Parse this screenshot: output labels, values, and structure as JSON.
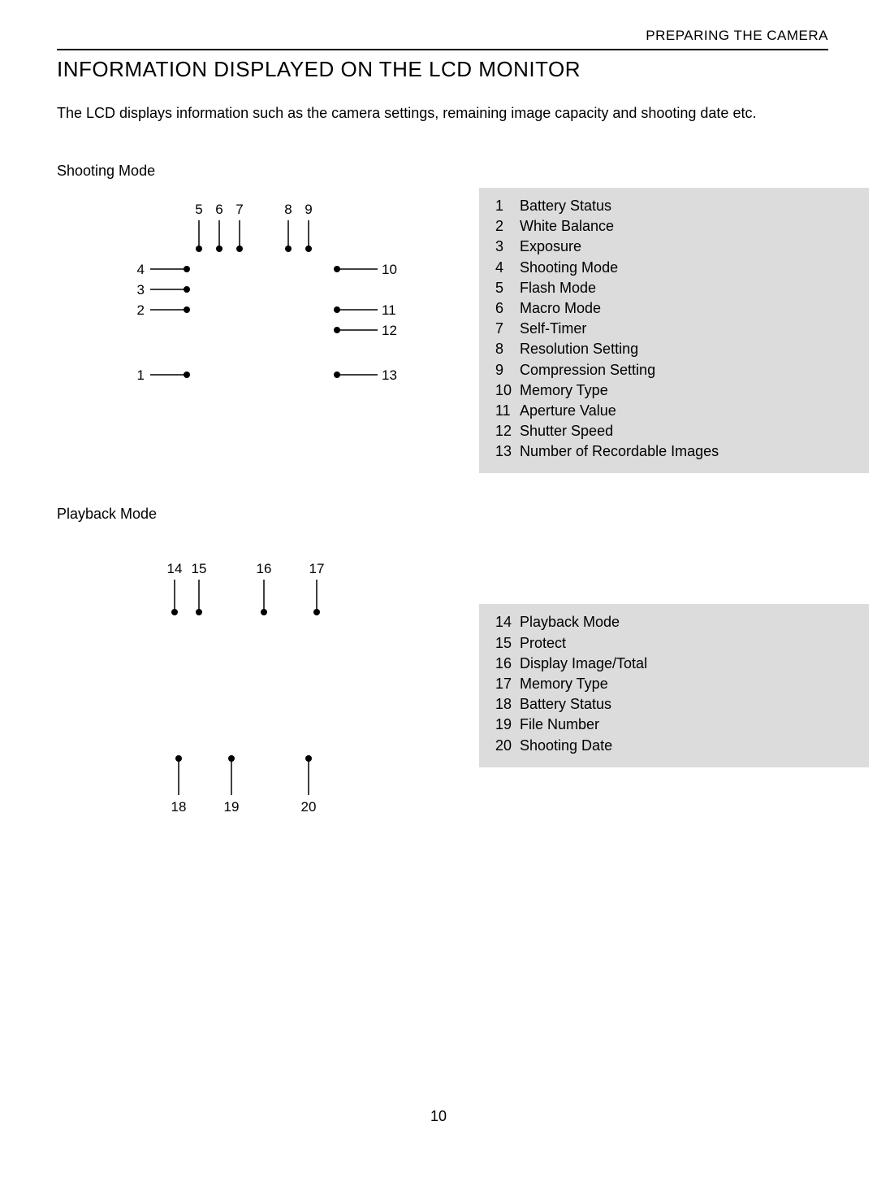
{
  "header": {
    "chapter": "PREPARING THE CAMERA",
    "title": "INFORMATION DISPLAYED ON THE LCD MONITOR",
    "intro": "The LCD displays information such as the camera settings, remaining image capacity and shooting date etc."
  },
  "shooting": {
    "heading": "Shooting Mode",
    "callouts": [
      "1",
      "2",
      "3",
      "4",
      "5",
      "6",
      "7",
      "8",
      "9",
      "10",
      "11",
      "12",
      "13"
    ],
    "legend": [
      {
        "n": "1",
        "label": "Battery Status"
      },
      {
        "n": "2",
        "label": "White Balance"
      },
      {
        "n": "3",
        "label": "Exposure"
      },
      {
        "n": "4",
        "label": "Shooting Mode"
      },
      {
        "n": "5",
        "label": "Flash Mode"
      },
      {
        "n": "6",
        "label": "Macro Mode"
      },
      {
        "n": "7",
        "label": "Self-Timer"
      },
      {
        "n": "8",
        "label": "Resolution Setting"
      },
      {
        "n": "9",
        "label": "Compression Setting"
      },
      {
        "n": "10",
        "label": "Memory Type"
      },
      {
        "n": "11",
        "label": "Aperture Value"
      },
      {
        "n": "12",
        "label": "Shutter Speed"
      },
      {
        "n": "13",
        "label": "Number of Recordable Images"
      }
    ]
  },
  "playback": {
    "heading": "Playback Mode",
    "callouts": [
      "14",
      "15",
      "16",
      "17",
      "18",
      "19",
      "20"
    ],
    "legend": [
      {
        "n": "14",
        "label": "Playback Mode"
      },
      {
        "n": "15",
        "label": "Protect"
      },
      {
        "n": "16",
        "label": "Display Image/Total"
      },
      {
        "n": "17",
        "label": "Memory Type"
      },
      {
        "n": "18",
        "label": "Battery Status"
      },
      {
        "n": "19",
        "label": "File Number"
      },
      {
        "n": "20",
        "label": "Shooting Date"
      }
    ]
  },
  "page_number": "10"
}
